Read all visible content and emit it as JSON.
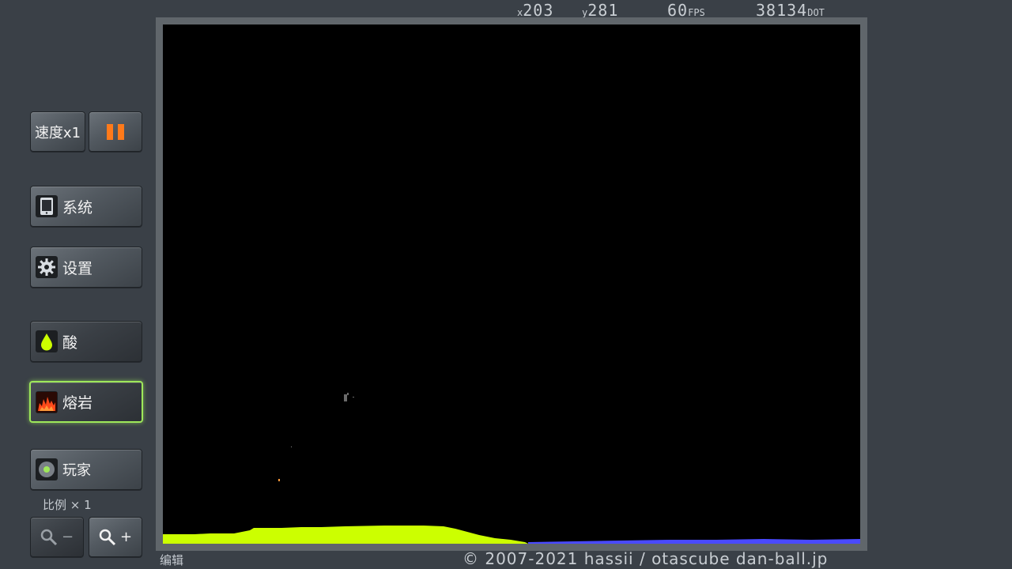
{
  "status": {
    "x_label": "x",
    "x_value": "203",
    "y_label": "y",
    "y_value": "281",
    "fps_value": "60",
    "fps_unit": "FPS",
    "dot_value": "38134",
    "dot_unit": "DOT"
  },
  "controls": {
    "speed_label": "速度x1",
    "pause_icon": "pause-icon"
  },
  "menu": {
    "system_label": "系统",
    "settings_label": "设置"
  },
  "tools": {
    "acid_label": "酸",
    "lava_label": "熔岩",
    "player_label": "玩家"
  },
  "zoom": {
    "scale_label": "比例 × 1",
    "zoom_out_label": "−",
    "zoom_in_label": "+"
  },
  "footer": {
    "edit_label": "编辑",
    "copyright": "© 2007-2021 hassii / otascube  dan-ball.jp"
  },
  "colors": {
    "acid": "#ccff00",
    "water": "#4a4aff",
    "lava": "#ff4a1a",
    "selected_border": "#9ee85a",
    "pause": "#ff7a1a"
  }
}
